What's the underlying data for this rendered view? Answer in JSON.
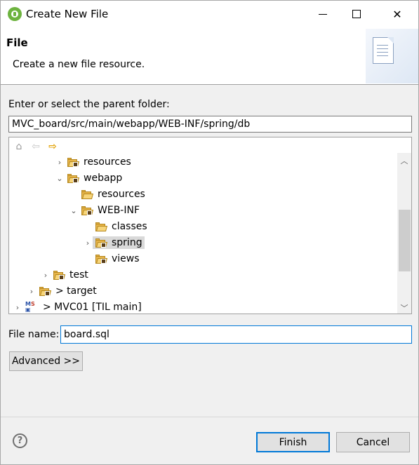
{
  "window": {
    "title": "Create New File",
    "controls": {
      "minimize": "minimize-icon",
      "maximize": "maximize-icon",
      "close": "close-icon"
    }
  },
  "banner": {
    "title": "File",
    "description": "Create a new file resource."
  },
  "parent_folder": {
    "label": "Enter or select the parent folder:",
    "value": "MVC_board/src/main/webapp/WEB-INF/spring/db"
  },
  "tree": {
    "items": [
      {
        "label": "resources",
        "expanded": false,
        "icon": "package-folder-icon"
      },
      {
        "label": "webapp",
        "expanded": true,
        "icon": "package-folder-icon"
      },
      {
        "label": "resources",
        "expanded": null,
        "icon": "folder-icon"
      },
      {
        "label": "WEB-INF",
        "expanded": true,
        "icon": "package-folder-icon"
      },
      {
        "label": "classes",
        "expanded": null,
        "icon": "folder-icon"
      },
      {
        "label": "spring",
        "expanded": false,
        "icon": "package-folder-icon",
        "selected": true
      },
      {
        "label": "views",
        "expanded": null,
        "icon": "package-folder-icon"
      },
      {
        "label": "test",
        "expanded": false,
        "icon": "package-folder-icon"
      },
      {
        "label": "> target",
        "expanded": false,
        "icon": "package-folder-icon"
      },
      {
        "label": "> MVC01 [TIL main]",
        "expanded": false,
        "icon": "maven-project-icon"
      }
    ]
  },
  "file_name": {
    "label": "File name:",
    "value": "board.sql"
  },
  "buttons": {
    "advanced": "Advanced >>",
    "finish": "Finish",
    "cancel": "Cancel"
  },
  "colors": {
    "accent": "#0078d7",
    "folder": "#e8b54a",
    "selection": "#d9d9d9"
  }
}
